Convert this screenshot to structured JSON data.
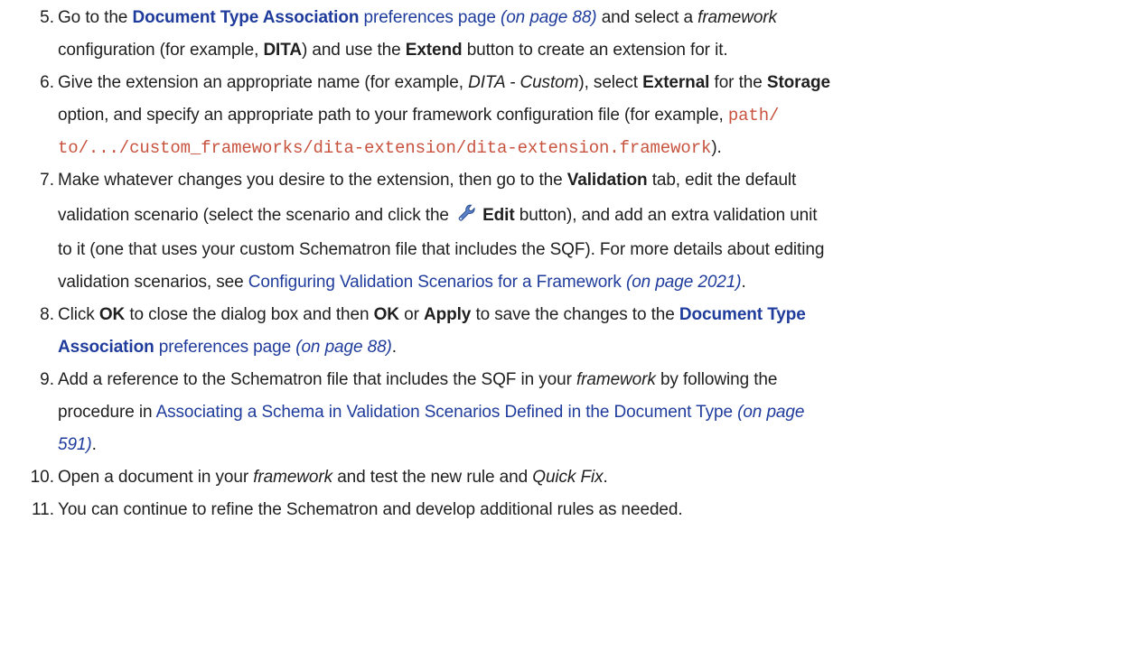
{
  "steps": [
    {
      "num": "5.",
      "lines": [
        [
          {
            "t": "Go to the ",
            "s": ""
          },
          {
            "t": "Document Type Association",
            "s": "lnk b",
            "link": true
          },
          {
            "t": " preferences page",
            "s": "lnk",
            "link": true
          },
          {
            "t": " (on page 88)",
            "s": "lnk i",
            "link": true
          },
          {
            "t": " and select a ",
            "s": ""
          },
          {
            "t": "framework",
            "s": "i"
          }
        ],
        [
          {
            "t": "configuration (for example, ",
            "s": ""
          },
          {
            "t": "DITA",
            "s": "b"
          },
          {
            "t": ") and use the ",
            "s": ""
          },
          {
            "t": "Extend",
            "s": "b"
          },
          {
            "t": " button to create an extension for it.",
            "s": ""
          }
        ]
      ]
    },
    {
      "num": "6.",
      "lines": [
        [
          {
            "t": "Give the extension an appropriate name (for example, ",
            "s": ""
          },
          {
            "t": "DITA - Custom",
            "s": "i"
          },
          {
            "t": "), select ",
            "s": ""
          },
          {
            "t": "External",
            "s": "b"
          },
          {
            "t": " for the ",
            "s": ""
          },
          {
            "t": "Storage",
            "s": "b"
          }
        ],
        [
          {
            "t": "option, and specify an appropriate path to your framework configuration file (for example, ",
            "s": ""
          },
          {
            "t": "path/",
            "s": "code"
          }
        ],
        [
          {
            "t": "to/.../custom_frameworks/dita-extension/dita-extension.framework",
            "s": "code"
          },
          {
            "t": ").",
            "s": ""
          }
        ]
      ]
    },
    {
      "num": "7.",
      "lines": [
        [
          {
            "t": "Make whatever changes you desire to the extension, then go to the ",
            "s": ""
          },
          {
            "t": "Validation",
            "s": "b"
          },
          {
            "t": " tab, edit the default",
            "s": ""
          }
        ],
        [
          {
            "t": "validation scenario (select the scenario and click the ",
            "s": ""
          },
          {
            "icon": "wrench-icon"
          },
          {
            "t": "Edit",
            "s": "b"
          },
          {
            "t": " button), and add an extra validation unit",
            "s": ""
          }
        ],
        [
          {
            "t": "to it (one that uses your custom Schematron file that includes the SQF). For more details about editing",
            "s": ""
          }
        ],
        [
          {
            "t": "validation scenarios, see ",
            "s": ""
          },
          {
            "t": "Configuring Validation Scenarios for a Framework",
            "s": "lnk",
            "link": true
          },
          {
            "t": " (on page 2021)",
            "s": "lnk i",
            "link": true
          },
          {
            "t": ".",
            "s": ""
          }
        ]
      ]
    },
    {
      "num": "8.",
      "lines": [
        [
          {
            "t": "Click ",
            "s": ""
          },
          {
            "t": "OK",
            "s": "b"
          },
          {
            "t": " to close the dialog box and then ",
            "s": ""
          },
          {
            "t": "OK",
            "s": "b"
          },
          {
            "t": " or ",
            "s": ""
          },
          {
            "t": "Apply",
            "s": "b"
          },
          {
            "t": " to save the changes to the ",
            "s": ""
          },
          {
            "t": "Document Type",
            "s": "lnk b",
            "link": true
          }
        ],
        [
          {
            "t": "Association",
            "s": "lnk b",
            "link": true
          },
          {
            "t": " preferences page",
            "s": "lnk",
            "link": true
          },
          {
            "t": " (on page 88)",
            "s": "lnk i",
            "link": true
          },
          {
            "t": ".",
            "s": ""
          }
        ]
      ]
    },
    {
      "num": "9.",
      "lines": [
        [
          {
            "t": "Add a reference to the Schematron file that includes the SQF in your ",
            "s": ""
          },
          {
            "t": "framework",
            "s": "i"
          },
          {
            "t": " by following the",
            "s": ""
          }
        ],
        [
          {
            "t": "procedure in ",
            "s": ""
          },
          {
            "t": "Associating a Schema in Validation Scenarios Defined in the Document Type",
            "s": "lnk",
            "link": true
          },
          {
            "t": " (on page",
            "s": "lnk i",
            "link": true
          }
        ],
        [
          {
            "t": "591)",
            "s": "lnk i",
            "link": true
          },
          {
            "t": ".",
            "s": ""
          }
        ]
      ]
    },
    {
      "num": "10.",
      "lines": [
        [
          {
            "t": "Open a document in your ",
            "s": ""
          },
          {
            "t": "framework",
            "s": "i"
          },
          {
            "t": " and test the new rule and ",
            "s": ""
          },
          {
            "t": "Quick Fix",
            "s": "i"
          },
          {
            "t": ".",
            "s": ""
          }
        ]
      ]
    },
    {
      "num": "11.",
      "lines": [
        [
          {
            "t": "You can continue to refine the Schematron and develop additional rules as needed.",
            "s": ""
          }
        ]
      ]
    }
  ]
}
